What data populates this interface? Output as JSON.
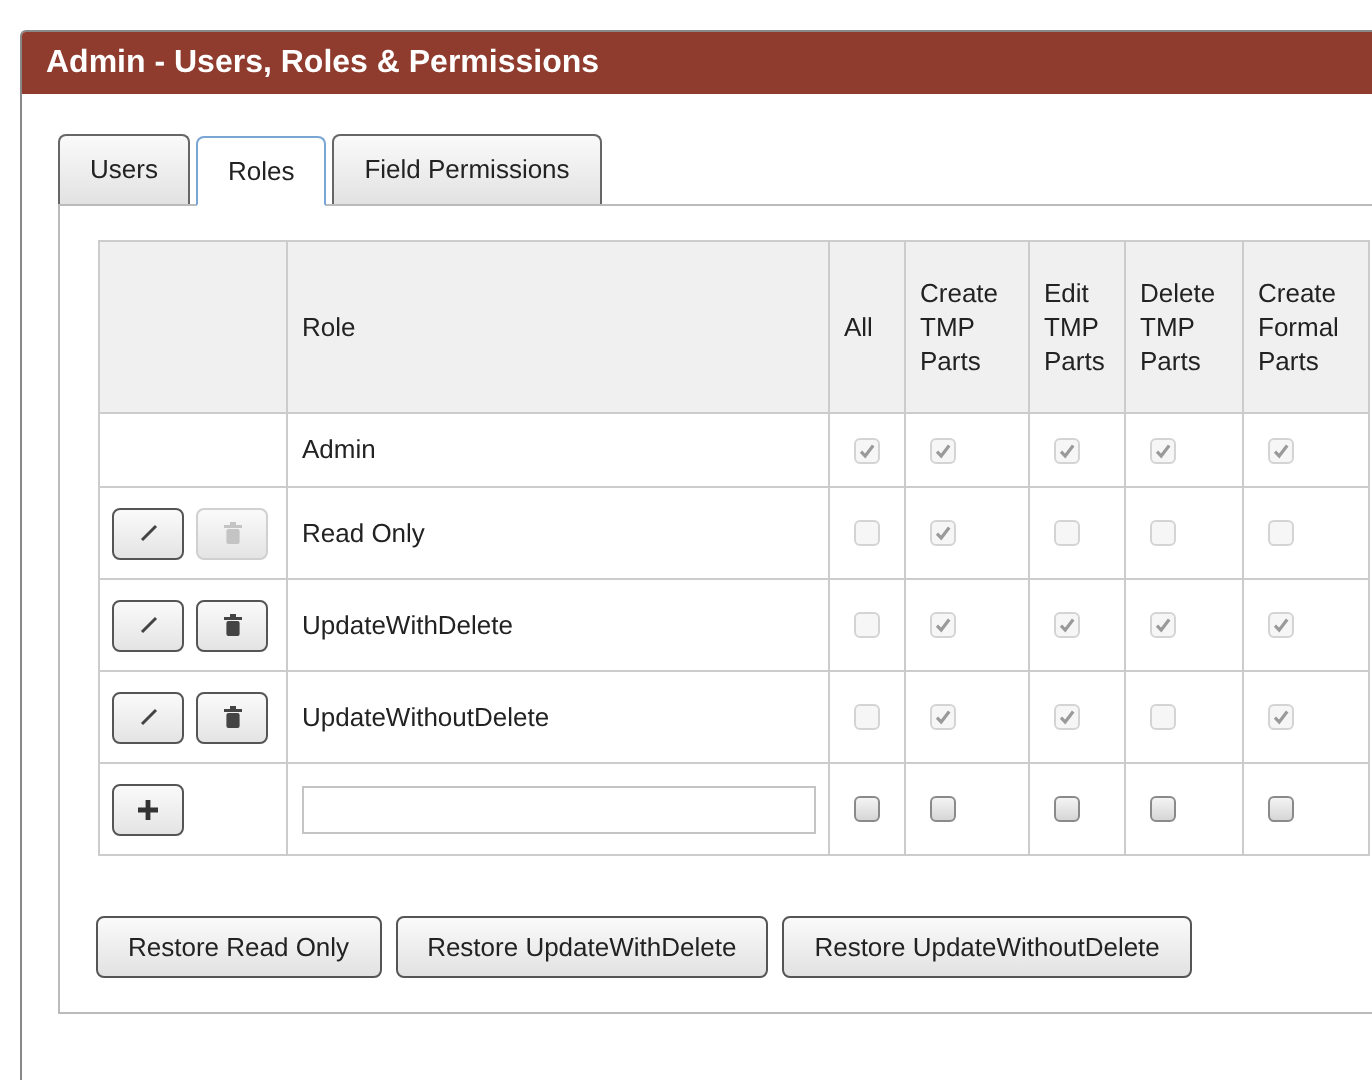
{
  "window": {
    "title": "Admin - Users, Roles & Permissions"
  },
  "tabs": [
    {
      "label": "Users",
      "selected": false
    },
    {
      "label": "Roles",
      "selected": true
    },
    {
      "label": "Field Permissions",
      "selected": false
    }
  ],
  "table": {
    "columns": [
      "Role",
      "All",
      "Create TMP Parts",
      "Edit TMP Parts",
      "Delete TMP Parts",
      "Create Formal Parts"
    ],
    "rows": [
      {
        "kind": "fixed",
        "name": "Admin",
        "permissions": [
          {
            "checked": true,
            "disabled": true
          },
          {
            "checked": true,
            "disabled": true
          },
          {
            "checked": true,
            "disabled": true
          },
          {
            "checked": true,
            "disabled": true
          },
          {
            "checked": true,
            "disabled": true
          }
        ]
      },
      {
        "kind": "editable",
        "name": "Read Only",
        "delete_disabled": true,
        "permissions": [
          {
            "checked": false,
            "disabled": true
          },
          {
            "checked": true,
            "disabled": true
          },
          {
            "checked": false,
            "disabled": true
          },
          {
            "checked": false,
            "disabled": true
          },
          {
            "checked": false,
            "disabled": true
          }
        ]
      },
      {
        "kind": "editable",
        "name": "UpdateWithDelete",
        "delete_disabled": false,
        "permissions": [
          {
            "checked": false,
            "disabled": true
          },
          {
            "checked": true,
            "disabled": true
          },
          {
            "checked": true,
            "disabled": true
          },
          {
            "checked": true,
            "disabled": true
          },
          {
            "checked": true,
            "disabled": true
          }
        ]
      },
      {
        "kind": "editable",
        "name": "UpdateWithoutDelete",
        "delete_disabled": false,
        "permissions": [
          {
            "checked": false,
            "disabled": true
          },
          {
            "checked": true,
            "disabled": true
          },
          {
            "checked": true,
            "disabled": true
          },
          {
            "checked": false,
            "disabled": true
          },
          {
            "checked": true,
            "disabled": true
          }
        ]
      },
      {
        "kind": "new",
        "permissions": [
          {
            "checked": false,
            "disabled": false
          },
          {
            "checked": false,
            "disabled": false
          },
          {
            "checked": false,
            "disabled": false
          },
          {
            "checked": false,
            "disabled": false
          },
          {
            "checked": false,
            "disabled": false
          }
        ]
      }
    ]
  },
  "buttons": [
    "Restore Read Only",
    "Restore UpdateWithDelete",
    "Restore UpdateWithoutDelete"
  ]
}
